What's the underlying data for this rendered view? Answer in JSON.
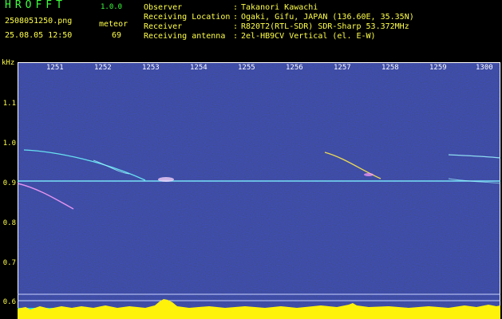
{
  "header": {
    "logo": "HROFFT",
    "version": "1.0.0",
    "filename": "2508051250.png",
    "datetime": "25.08.05 12:50",
    "meteor_label": "meteor",
    "meteor_count": "69"
  },
  "info": [
    {
      "key": "Observer",
      "sep": ":",
      "value": "Takanori Kawachi"
    },
    {
      "key": "Receiving Location",
      "sep": ":",
      "value": "Ogaki, Gifu, JAPAN (136.60E, 35.35N)"
    },
    {
      "key": "Receiver",
      "sep": ":",
      "value": "R820T2(RTL-SDR) SDR-Sharp 53.372MHz"
    },
    {
      "key": "Receiving antenna",
      "sep": ":",
      "value": "2el-HB9CV Vertical (el. E-W)"
    }
  ],
  "y_axis": {
    "unit": "kHz",
    "ticks": [
      "1.1",
      "1.0",
      "0.9",
      "0.8",
      "0.7",
      "0.6"
    ]
  },
  "x_axis": {
    "ticks": [
      "1251",
      "1252",
      "1253",
      "1254",
      "1255",
      "1256",
      "1257",
      "1258",
      "1259",
      "1300"
    ]
  },
  "colors": {
    "header_green": "#3cff3c",
    "header_yellow": "#ffff4a",
    "spectrum_bg": "#0a0560",
    "carrier": "#7ef0ff",
    "bar_cyan": "#10d8ff",
    "bar_yellow": "#fff20a"
  }
}
